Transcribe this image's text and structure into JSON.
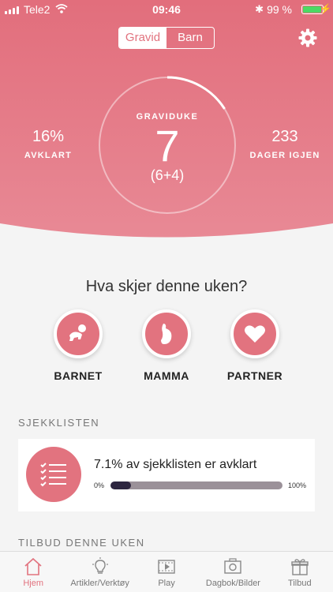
{
  "status": {
    "carrier": "Tele2",
    "time": "09:46",
    "battery": "99 %"
  },
  "segment": {
    "options": [
      "Gravid",
      "Barn"
    ],
    "selected": "Gravid"
  },
  "progress": {
    "label": "GRAVIDUKE",
    "week": "7",
    "sub": "(6+4)",
    "ring_fraction": 0.16,
    "left": {
      "value": "16%",
      "label": "AVKLART"
    },
    "right": {
      "value": "233",
      "label": "DAGER IGJEN"
    }
  },
  "question": "Hva skjer denne uken?",
  "categories": [
    {
      "label": "BARNET",
      "icon": "baby-crawling-icon"
    },
    {
      "label": "MAMMA",
      "icon": "pregnant-belly-icon"
    },
    {
      "label": "PARTNER",
      "icon": "heart-icon"
    }
  ],
  "checklist": {
    "title": "SJEKKLISTEN",
    "text": "7.1% av sjekklisten er avklart",
    "min_label": "0%",
    "max_label": "100%",
    "progress": 0.071
  },
  "offers_title": "TILBUD DENNE UKEN",
  "tabs": [
    {
      "label": "Hjem",
      "icon": "home-icon",
      "active": true
    },
    {
      "label": "Artikler/Verktøy",
      "icon": "lightbulb-icon",
      "active": false
    },
    {
      "label": "Play",
      "icon": "video-play-icon",
      "active": false
    },
    {
      "label": "Dagbok/Bilder",
      "icon": "camera-icon",
      "active": false
    },
    {
      "label": "Tilbud",
      "icon": "gift-icon",
      "active": false
    }
  ],
  "colors": {
    "accent": "#e2737f",
    "bar_fill": "#2d2640",
    "bar_track": "#9b9199"
  }
}
